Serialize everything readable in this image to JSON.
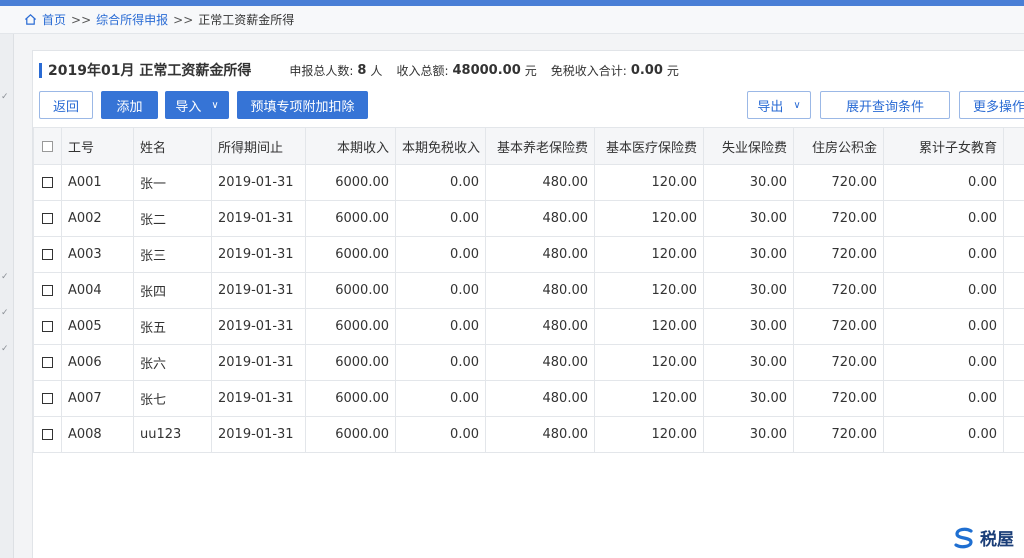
{
  "breadcrumb": {
    "home": "首页",
    "sep": ">>",
    "level2": "综合所得申报",
    "current": "正常工资薪金所得"
  },
  "summary": {
    "title": "2019年01月 正常工资薪金所得",
    "count_label": "申报总人数:",
    "count_value": "8",
    "count_unit": "人",
    "income_label": "收入总额:",
    "income_value": "48000.00",
    "income_unit": "元",
    "taxfree_label": "免税收入合计:",
    "taxfree_value": "0.00",
    "taxfree_unit": "元"
  },
  "toolbar": {
    "back": "返回",
    "add": "添加",
    "import": "导入",
    "prefill": "预填专项附加扣除",
    "export": "导出",
    "expand_query": "展开查询条件",
    "more": "更多操作"
  },
  "table": {
    "headers": [
      "工号",
      "姓名",
      "所得期间止",
      "本期收入",
      "本期免税收入",
      "基本养老保险费",
      "基本医疗保险费",
      "失业保险费",
      "住房公积金",
      "累计子女教育"
    ],
    "rows": [
      [
        "A001",
        "张一",
        "2019-01-31",
        "6000.00",
        "0.00",
        "480.00",
        "120.00",
        "30.00",
        "720.00",
        "0.00"
      ],
      [
        "A002",
        "张二",
        "2019-01-31",
        "6000.00",
        "0.00",
        "480.00",
        "120.00",
        "30.00",
        "720.00",
        "0.00"
      ],
      [
        "A003",
        "张三",
        "2019-01-31",
        "6000.00",
        "0.00",
        "480.00",
        "120.00",
        "30.00",
        "720.00",
        "0.00"
      ],
      [
        "A004",
        "张四",
        "2019-01-31",
        "6000.00",
        "0.00",
        "480.00",
        "120.00",
        "30.00",
        "720.00",
        "0.00"
      ],
      [
        "A005",
        "张五",
        "2019-01-31",
        "6000.00",
        "0.00",
        "480.00",
        "120.00",
        "30.00",
        "720.00",
        "0.00"
      ],
      [
        "A006",
        "张六",
        "2019-01-31",
        "6000.00",
        "0.00",
        "480.00",
        "120.00",
        "30.00",
        "720.00",
        "0.00"
      ],
      [
        "A007",
        "张七",
        "2019-01-31",
        "6000.00",
        "0.00",
        "480.00",
        "120.00",
        "30.00",
        "720.00",
        "0.00"
      ],
      [
        "A008",
        "uu123",
        "2019-01-31",
        "6000.00",
        "0.00",
        "480.00",
        "120.00",
        "30.00",
        "720.00",
        "0.00"
      ]
    ]
  },
  "watermark": {
    "text": "税屋"
  },
  "colors": {
    "accent": "#3674d6",
    "border": "#e3e6ea",
    "header_bg": "#f5f6f8"
  }
}
